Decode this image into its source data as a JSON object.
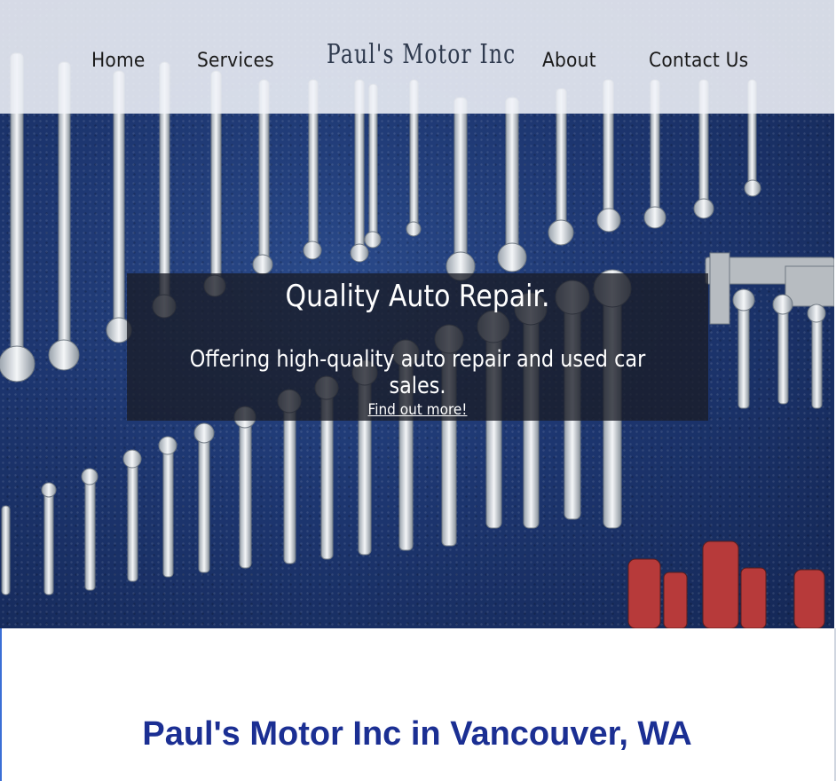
{
  "nav": {
    "home": "Home",
    "services": "Services",
    "brand": "Paul's Motor Inc",
    "about": "About",
    "contact": "Contact Us"
  },
  "hero": {
    "title": "Quality Auto Repair.",
    "subtitle": "Offering high-quality auto repair and used car sales.",
    "cta": "Find out more!"
  },
  "section": {
    "title": "Paul's Motor Inc in Vancouver, WA"
  },
  "colors": {
    "heading_blue": "#1b2f93",
    "overlay": "#191c26",
    "navbar": "#f0f3f8"
  }
}
